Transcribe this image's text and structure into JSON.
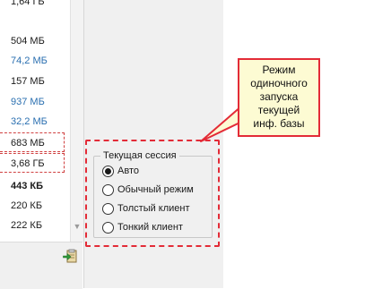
{
  "size_list": {
    "rows": [
      {
        "text": "1,64 ГБ",
        "style": "normal"
      },
      {
        "text": "504 МБ",
        "style": "normal"
      },
      {
        "text": "74,2 МБ",
        "style": "blue"
      },
      {
        "text": "157 МБ",
        "style": "normal"
      },
      {
        "text": "937 МБ",
        "style": "blue"
      },
      {
        "text": "32,2 МБ",
        "style": "blue"
      },
      {
        "text": "683 МБ",
        "style": "highlight"
      },
      {
        "text": "3,68 ГБ",
        "style": "highlight"
      },
      {
        "text": "443 КБ",
        "style": "bold"
      },
      {
        "text": "220 КБ",
        "style": "normal"
      },
      {
        "text": "222 КБ",
        "style": "normal"
      }
    ]
  },
  "callout": {
    "lines": [
      "Режим",
      "одиночного",
      "запуска",
      "текущей",
      "инф. базы"
    ]
  },
  "session": {
    "title": "Текущая сессия",
    "options": [
      {
        "label": "Авто",
        "checked": true
      },
      {
        "label": "Обычный режим",
        "checked": false
      },
      {
        "label": "Толстый клиент",
        "checked": false
      },
      {
        "label": "Тонкий клиент",
        "checked": false
      }
    ]
  },
  "icons": {
    "export": "export-icon",
    "scroll_down": "scroll-down-icon"
  },
  "colors": {
    "accent_red": "#e32b37",
    "link_blue": "#2a6fb0",
    "callout_bg": "#fdfbd3",
    "panel_bg": "#f0f0f0"
  }
}
